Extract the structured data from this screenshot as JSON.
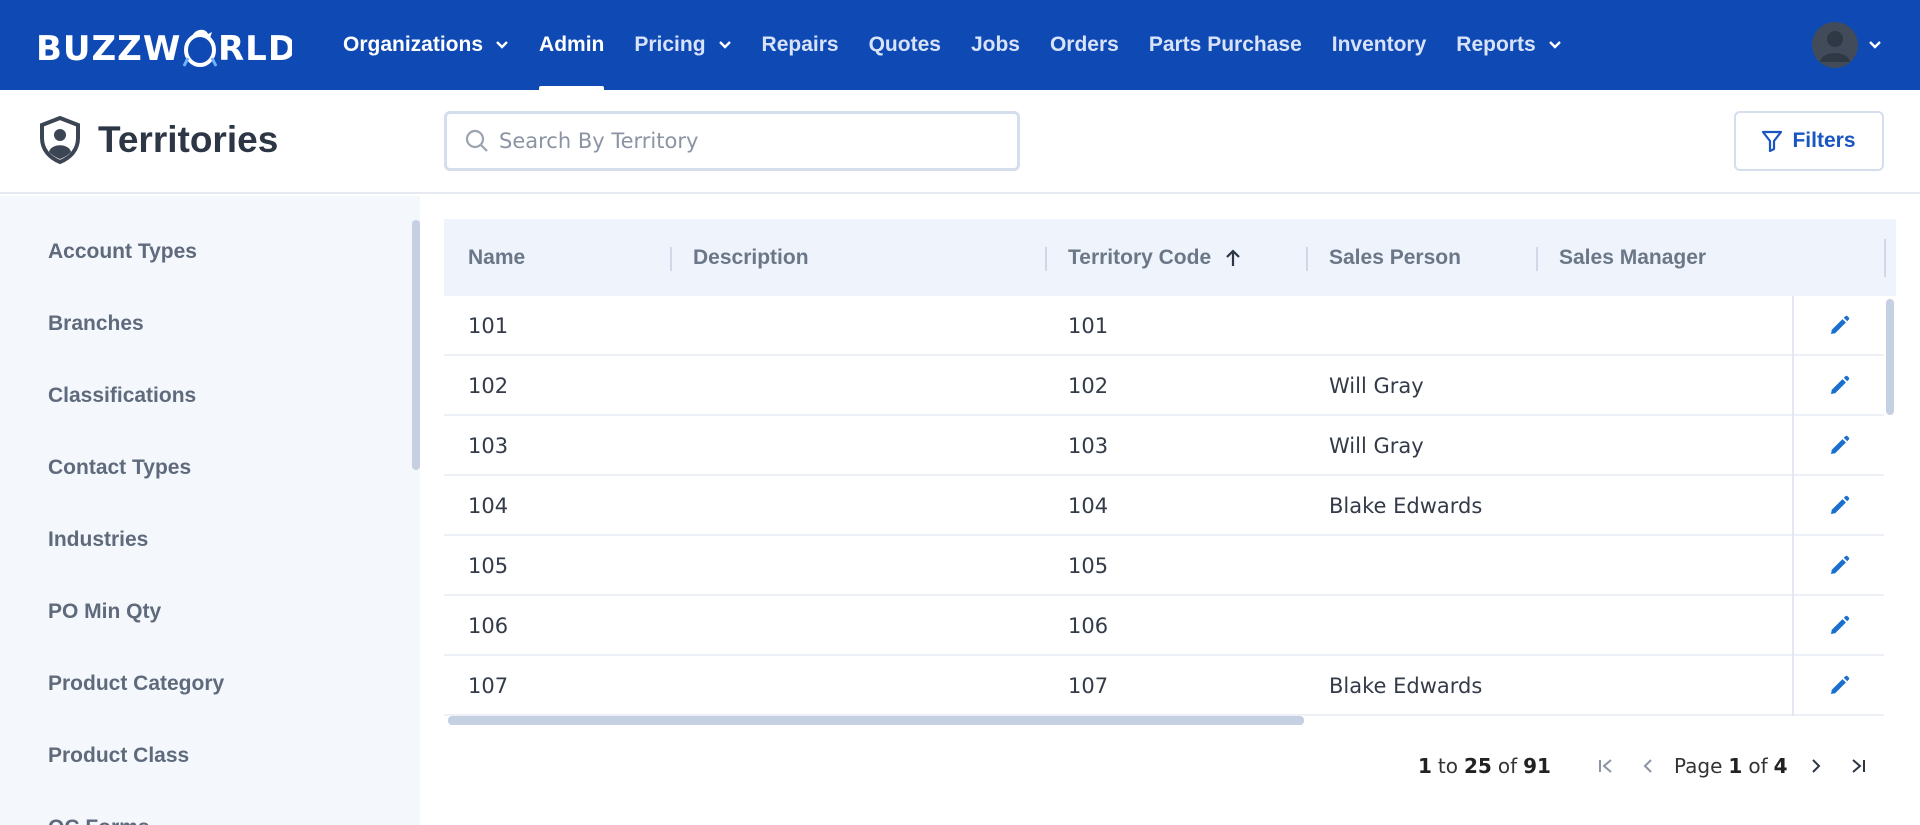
{
  "app": {
    "logo_text": "BUZZWORLD",
    "colors": {
      "nav_bg": "#0f49b3",
      "accent": "#1a56c2",
      "sidebar_bg": "#f4f7fc",
      "header_bg": "#eef3fc"
    }
  },
  "nav": {
    "items": [
      {
        "label": "Organizations",
        "dropdown": true
      },
      {
        "label": "Admin",
        "active": true
      },
      {
        "label": "Pricing",
        "dropdown": true
      },
      {
        "label": "Repairs"
      },
      {
        "label": "Quotes"
      },
      {
        "label": "Jobs"
      },
      {
        "label": "Orders"
      },
      {
        "label": "Parts Purchase"
      },
      {
        "label": "Inventory"
      },
      {
        "label": "Reports",
        "dropdown": true
      }
    ]
  },
  "header": {
    "title": "Territories",
    "search_placeholder": "Search By Territory",
    "filters_label": "Filters"
  },
  "sidebar": {
    "items": [
      {
        "label": "Account Types"
      },
      {
        "label": "Branches"
      },
      {
        "label": "Classifications"
      },
      {
        "label": "Contact Types"
      },
      {
        "label": "Industries"
      },
      {
        "label": "PO Min Qty"
      },
      {
        "label": "Product Category"
      },
      {
        "label": "Product Class"
      },
      {
        "label": "QC Forms"
      }
    ]
  },
  "table": {
    "columns": [
      {
        "label": "Name"
      },
      {
        "label": "Description"
      },
      {
        "label": "Territory Code",
        "sorted": "ascending"
      },
      {
        "label": "Sales Person"
      },
      {
        "label": "Sales Manager"
      }
    ],
    "rows": [
      {
        "name": "101",
        "description": "",
        "code": "101",
        "sales_person": "",
        "sales_manager": ""
      },
      {
        "name": "102",
        "description": "",
        "code": "102",
        "sales_person": "Will Gray",
        "sales_manager": ""
      },
      {
        "name": "103",
        "description": "",
        "code": "103",
        "sales_person": "Will Gray",
        "sales_manager": ""
      },
      {
        "name": "104",
        "description": "",
        "code": "104",
        "sales_person": "Blake Edwards",
        "sales_manager": ""
      },
      {
        "name": "105",
        "description": "",
        "code": "105",
        "sales_person": "",
        "sales_manager": ""
      },
      {
        "name": "106",
        "description": "",
        "code": "106",
        "sales_person": "",
        "sales_manager": ""
      },
      {
        "name": "107",
        "description": "",
        "code": "107",
        "sales_person": "Blake Edwards",
        "sales_manager": ""
      }
    ]
  },
  "pagination": {
    "range_start": "1",
    "to_text": "to",
    "range_end": "25",
    "of_text": "of",
    "total": "91",
    "page_text": "Page",
    "current_page": "1",
    "total_pages": "4"
  },
  "icons": {
    "search": "search-icon",
    "filter": "filter-icon",
    "edit": "pencil-icon",
    "sort": "arrow-up-icon",
    "first": "first-page-icon",
    "prev": "chevron-left-icon",
    "next": "chevron-right-icon",
    "last": "last-page-icon",
    "user": "user-avatar-icon",
    "title": "shield-user-icon"
  }
}
